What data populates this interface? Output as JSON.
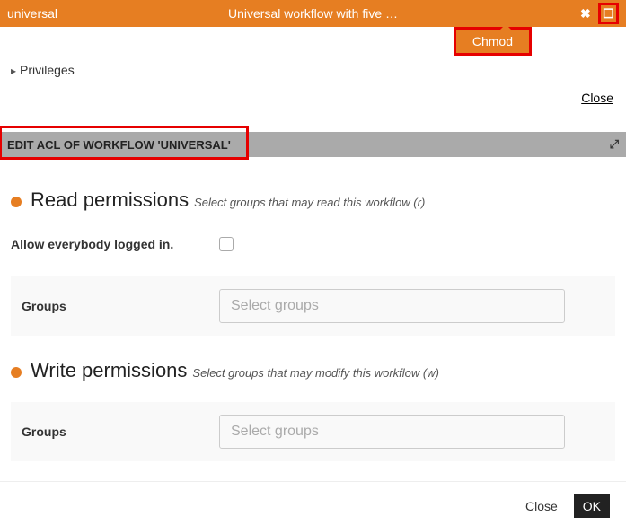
{
  "titlebar": {
    "left": "universal",
    "center": "Universal workflow with five …",
    "close_icon": "✖",
    "expand_icon": "◻"
  },
  "popover": {
    "label": "Chmod"
  },
  "privileges": {
    "label": "Privileges"
  },
  "actions": {
    "close": "Close",
    "ok": "OK"
  },
  "acl_header": {
    "title": "EDIT ACL OF WORKFLOW 'UNIVERSAL'"
  },
  "read_section": {
    "title": "Read permissions",
    "subtitle": "Select groups that may read this workflow (r)",
    "allow_label": "Allow everybody logged in.",
    "groups_label": "Groups",
    "groups_placeholder": "Select groups"
  },
  "write_section": {
    "title": "Write permissions",
    "subtitle": "Select groups that may modify this workflow (w)",
    "groups_label": "Groups",
    "groups_placeholder": "Select groups"
  }
}
